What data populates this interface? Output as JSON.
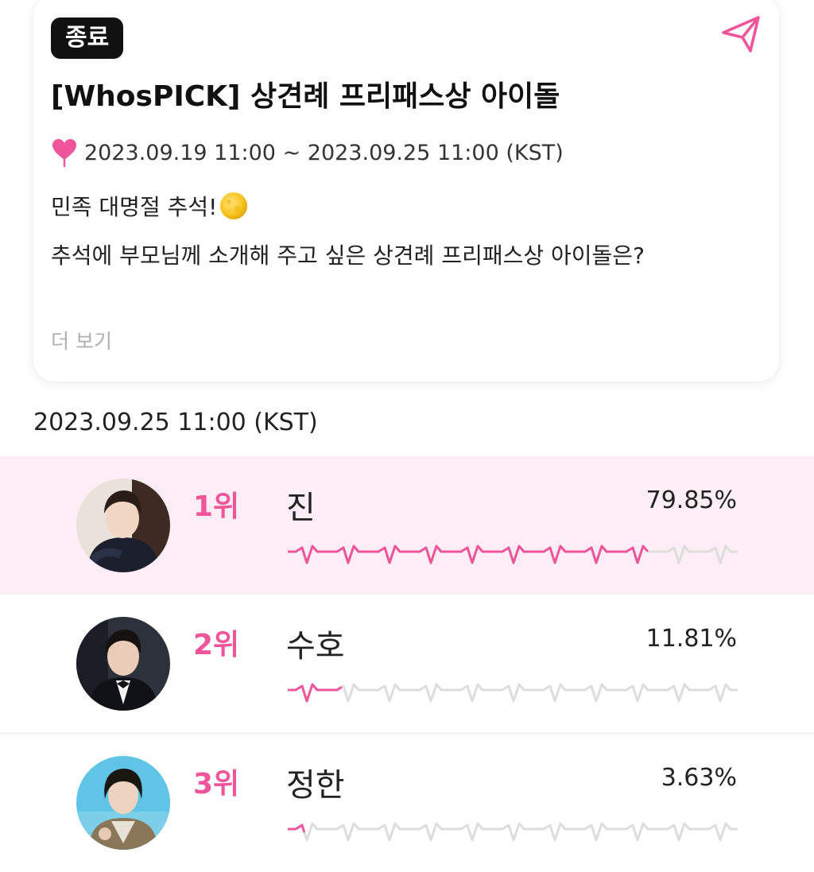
{
  "vote": {
    "status_badge": "종료",
    "title": "[WhosPICK] 상견례 프리패스상 아이돌",
    "period": "2023.09.19 11:00 ~ 2023.09.25 11:00 (KST)",
    "description_line1": "민족 대명절 추석!",
    "description_line2": "추석에 부모님께 소개해 주고 싶은 상견례 프리패스상 아이돌은?",
    "more_label": "더 보기"
  },
  "results": {
    "timestamp": "2023.09.25 11:00 (KST)",
    "items": [
      {
        "rank": "1위",
        "name": "진",
        "percent_label": "79.85%",
        "percent": 79.85
      },
      {
        "rank": "2위",
        "name": "수호",
        "percent_label": "11.81%",
        "percent": 11.81
      },
      {
        "rank": "3위",
        "name": "정한",
        "percent_label": "3.63%",
        "percent": 3.63
      }
    ]
  },
  "colors": {
    "accent": "#f0559b",
    "highlight_row": "#fdeef5",
    "badge_bg": "#111111",
    "wave_track": "#dddddd"
  },
  "icons": {
    "share": "send-icon",
    "period": "heart-icon",
    "emoji": "full-moon-emoji"
  }
}
